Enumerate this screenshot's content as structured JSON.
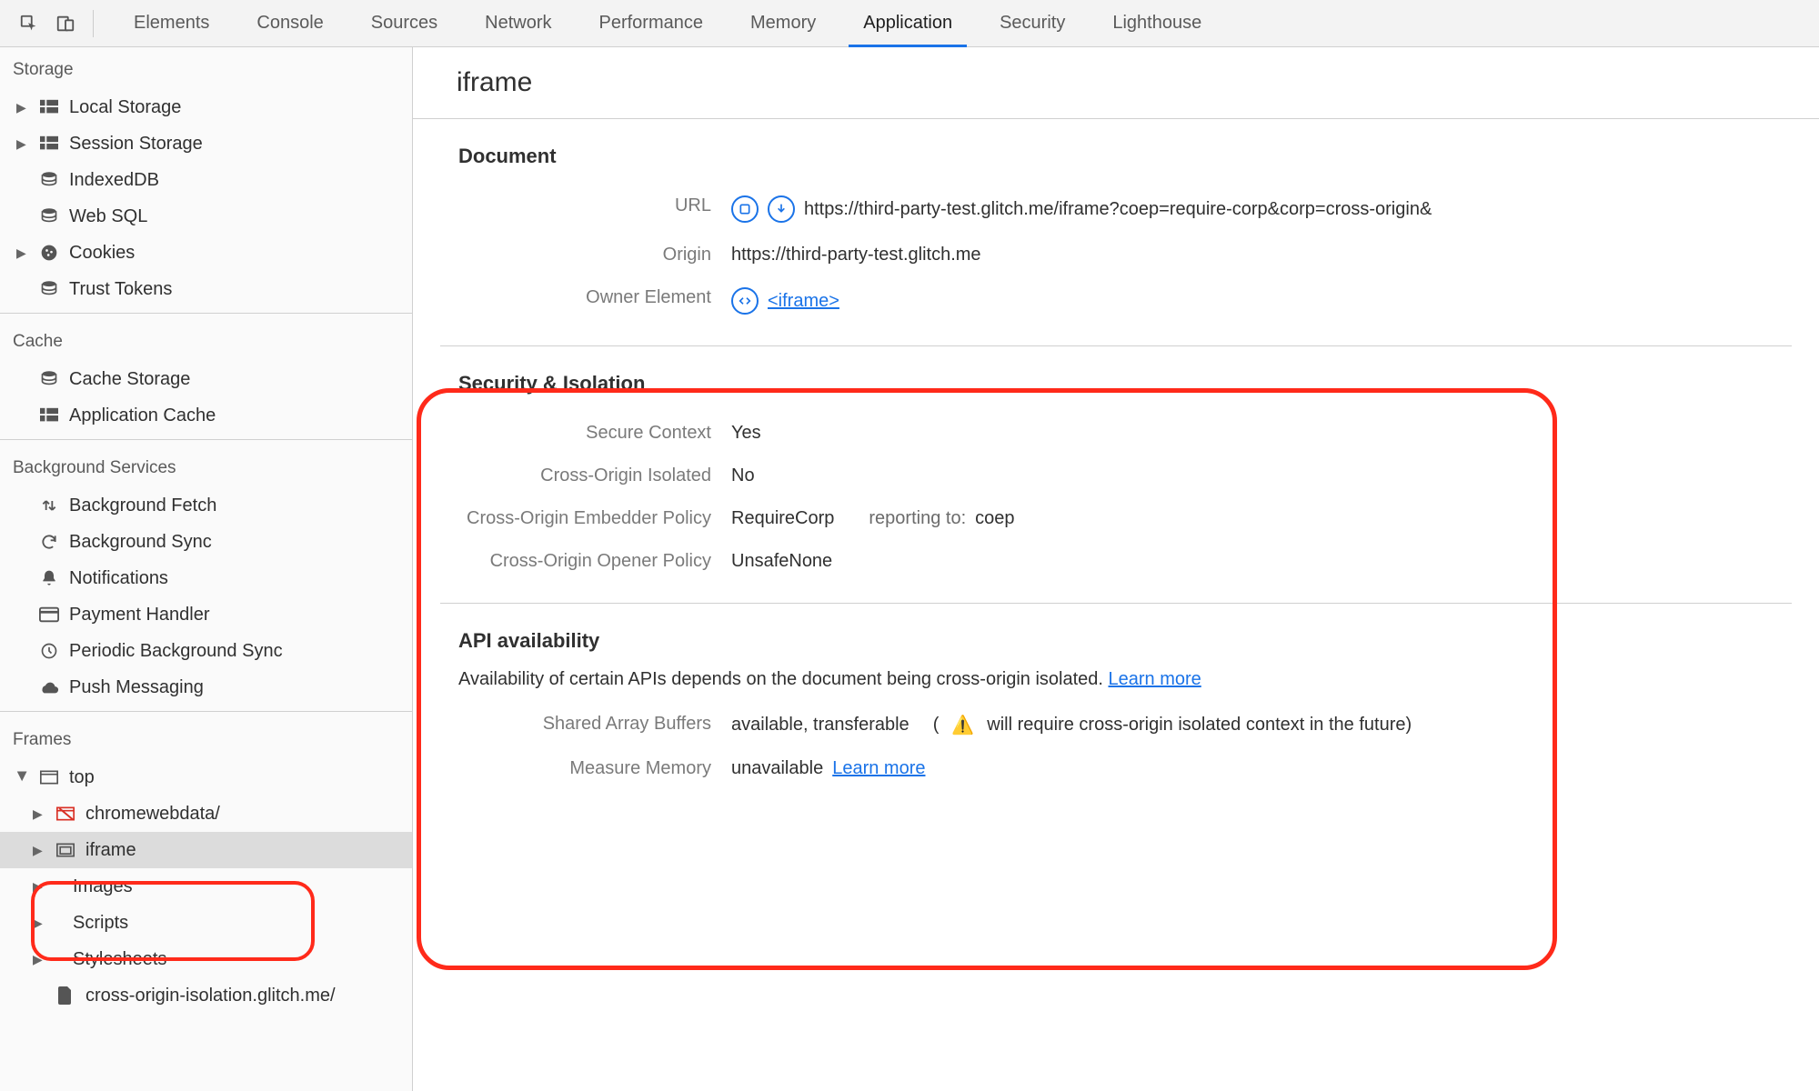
{
  "tabs": {
    "items": [
      "Elements",
      "Console",
      "Sources",
      "Network",
      "Performance",
      "Memory",
      "Application",
      "Security",
      "Lighthouse"
    ],
    "active": "Application"
  },
  "sidebar": {
    "storage": {
      "header": "Storage",
      "items": [
        {
          "label": "Local Storage",
          "icon": "grid",
          "expandable": true
        },
        {
          "label": "Session Storage",
          "icon": "grid",
          "expandable": true
        },
        {
          "label": "IndexedDB",
          "icon": "db",
          "expandable": false
        },
        {
          "label": "Web SQL",
          "icon": "db",
          "expandable": false
        },
        {
          "label": "Cookies",
          "icon": "cookie",
          "expandable": true
        },
        {
          "label": "Trust Tokens",
          "icon": "db",
          "expandable": false
        }
      ]
    },
    "cache": {
      "header": "Cache",
      "items": [
        {
          "label": "Cache Storage",
          "icon": "db"
        },
        {
          "label": "Application Cache",
          "icon": "grid"
        }
      ]
    },
    "bg": {
      "header": "Background Services",
      "items": [
        {
          "label": "Background Fetch",
          "icon": "updown"
        },
        {
          "label": "Background Sync",
          "icon": "sync"
        },
        {
          "label": "Notifications",
          "icon": "bell"
        },
        {
          "label": "Payment Handler",
          "icon": "card"
        },
        {
          "label": "Periodic Background Sync",
          "icon": "clock"
        },
        {
          "label": "Push Messaging",
          "icon": "cloud"
        }
      ]
    },
    "frames": {
      "header": "Frames",
      "top": "top",
      "chromewebdata": "chromewebdata/",
      "iframe": "iframe",
      "images": "Images",
      "scripts": "Scripts",
      "stylesheets": "Stylesheets",
      "doc": "cross-origin-isolation.glitch.me/"
    }
  },
  "main": {
    "title": "iframe",
    "document": {
      "heading": "Document",
      "url_label": "URL",
      "url": "https://third-party-test.glitch.me/iframe?coep=require-corp&corp=cross-origin&",
      "origin_label": "Origin",
      "origin": "https://third-party-test.glitch.me",
      "owner_label": "Owner Element",
      "owner_link": "<iframe>"
    },
    "security": {
      "heading": "Security & Isolation",
      "secure_label": "Secure Context",
      "secure_val": "Yes",
      "coi_label": "Cross-Origin Isolated",
      "coi_val": "No",
      "coep_label": "Cross-Origin Embedder Policy",
      "coep_val": "RequireCorp",
      "coep_reporting_prefix": "reporting to:",
      "coep_reporting_val": "coep",
      "coop_label": "Cross-Origin Opener Policy",
      "coop_val": "UnsafeNone"
    },
    "api": {
      "heading": "API availability",
      "desc": "Availability of certain APIs depends on the document being cross-origin isolated.",
      "learn_more": "Learn more",
      "sab_label": "Shared Array Buffers",
      "sab_val": "available, transferable",
      "sab_warn_prefix": "(",
      "sab_warn": "will require cross-origin isolated context in the future)",
      "mm_label": "Measure Memory",
      "mm_val": "unavailable"
    }
  }
}
